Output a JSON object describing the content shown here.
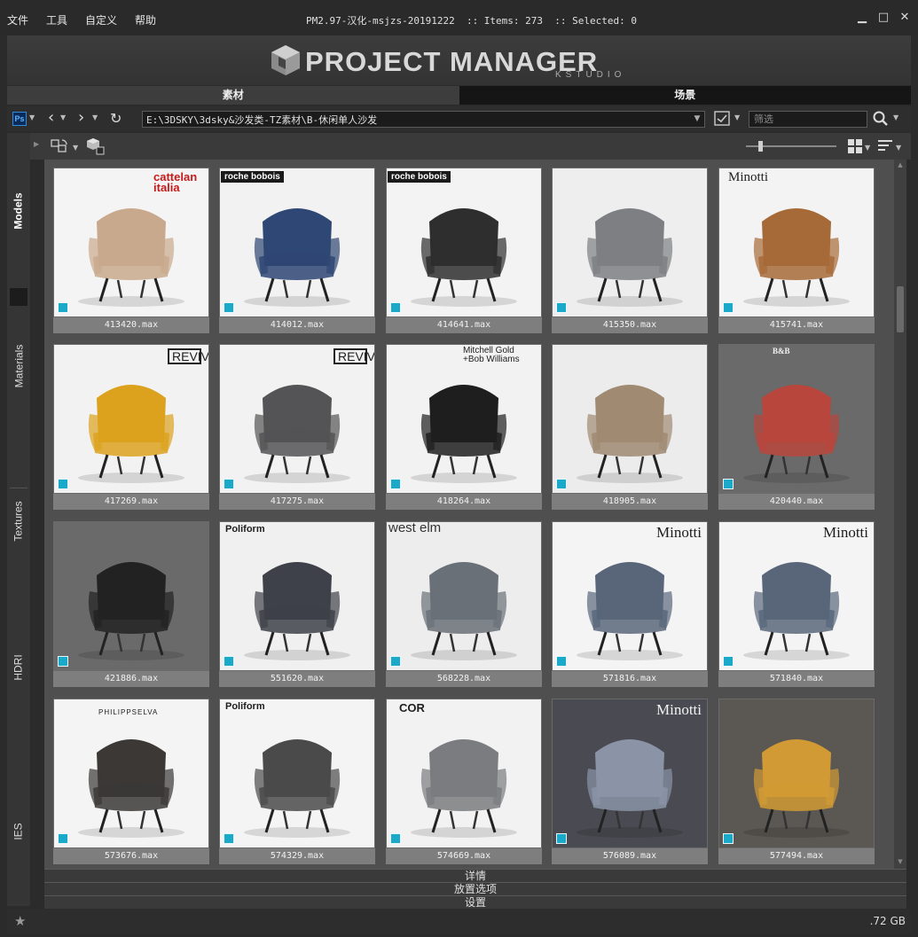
{
  "menu": [
    "文件",
    "工具",
    "自定义",
    "帮助"
  ],
  "window_title": "PM2.97-汉化-msjzs-20191222  :: Items: 273  :: Selected: 0",
  "window_controls": [
    "minimize-icon",
    "maximize-icon",
    "close-icon"
  ],
  "logo": {
    "title": "PROJECT MANAGER",
    "subtitle": "KSTUDIO"
  },
  "tabs": [
    {
      "label": "素材",
      "active": true
    },
    {
      "label": "场景",
      "active": false
    }
  ],
  "toolbar": {
    "ps_label": "Ps",
    "path": "E:\\3DSKY\\3dsky&沙发类-TZ素材\\B-休闲单人沙发",
    "filter_placeholder": "筛选"
  },
  "sidebar": [
    {
      "label": "Models",
      "active": true
    },
    {
      "label": "Materials",
      "active": false
    },
    {
      "label": "Textures",
      "active": false
    },
    {
      "label": "HDRI",
      "active": false
    },
    {
      "label": "IES",
      "active": false
    }
  ],
  "items": [
    {
      "file": "413420.max",
      "brand": "cattelan italia",
      "accent": "#c9a98d",
      "bg": "#f4f4f4"
    },
    {
      "file": "414012.max",
      "brand": "roche bobois",
      "accent": "#2f4774",
      "bg": "#f2f2f2"
    },
    {
      "file": "414641.max",
      "brand": "roche bobois",
      "accent": "#2e2e2e",
      "bg": "#f3f3f3"
    },
    {
      "file": "415350.max",
      "brand": "",
      "accent": "#7d7f82",
      "bg": "#eeeeee"
    },
    {
      "file": "415741.max",
      "brand": "Minotti",
      "accent": "#a66a38",
      "bg": "#f3f3f3"
    },
    {
      "file": "417269.max",
      "brand": "REVIVE",
      "accent": "#dca21e",
      "bg": "#f2f2f2"
    },
    {
      "file": "417275.max",
      "brand": "REVIVE",
      "accent": "#545456",
      "bg": "#f2f2f2"
    },
    {
      "file": "418264.max",
      "brand": "Mitchell Gold +Bob Williams",
      "accent": "#1e1e1e",
      "bg": "#f2f2f2"
    },
    {
      "file": "418905.max",
      "brand": "",
      "accent": "#a08a72",
      "bg": "#ececec"
    },
    {
      "file": "420440.max",
      "brand": "B&B",
      "accent": "#b9463c",
      "bg": "#6a6a6a"
    },
    {
      "file": "421886.max",
      "brand": "",
      "accent": "#222222",
      "bg": "#6a6a6a"
    },
    {
      "file": "551620.max",
      "brand": "Poliform",
      "accent": "#3e4149",
      "bg": "#f0f0f0"
    },
    {
      "file": "568228.max",
      "brand": "west elm",
      "accent": "#6a7077",
      "bg": "#ededed"
    },
    {
      "file": "571816.max",
      "brand": "Minotti",
      "accent": "#59667a",
      "bg": "#f4f4f4"
    },
    {
      "file": "571840.max",
      "brand": "Minotti",
      "accent": "#59667a",
      "bg": "#f4f4f4"
    },
    {
      "file": "573676.max",
      "brand": "PHILIPPSELVA",
      "accent": "#3b3836",
      "bg": "#f4f4f4"
    },
    {
      "file": "574329.max",
      "brand": "Poliform",
      "accent": "#4a4a4a",
      "bg": "#f4f4f4"
    },
    {
      "file": "574669.max",
      "brand": "COR",
      "accent": "#7a7c7f",
      "bg": "#f2f2f2"
    },
    {
      "file": "576089.max",
      "brand": "Minotti",
      "accent": "#8a94a6",
      "bg": "#4a4a52"
    },
    {
      "file": "577494.max",
      "brand": "",
      "accent": "#d29a34",
      "bg": "#5b5752"
    }
  ],
  "bottom_panels": [
    "详情",
    "放置选项",
    "设置"
  ],
  "status": {
    "disk": ".72 GB"
  },
  "colors": {
    "background": "#2b2b2b",
    "card": "#6a6a6a",
    "caption": "#7e7e7e",
    "max_badge": "#1aa9c8"
  }
}
